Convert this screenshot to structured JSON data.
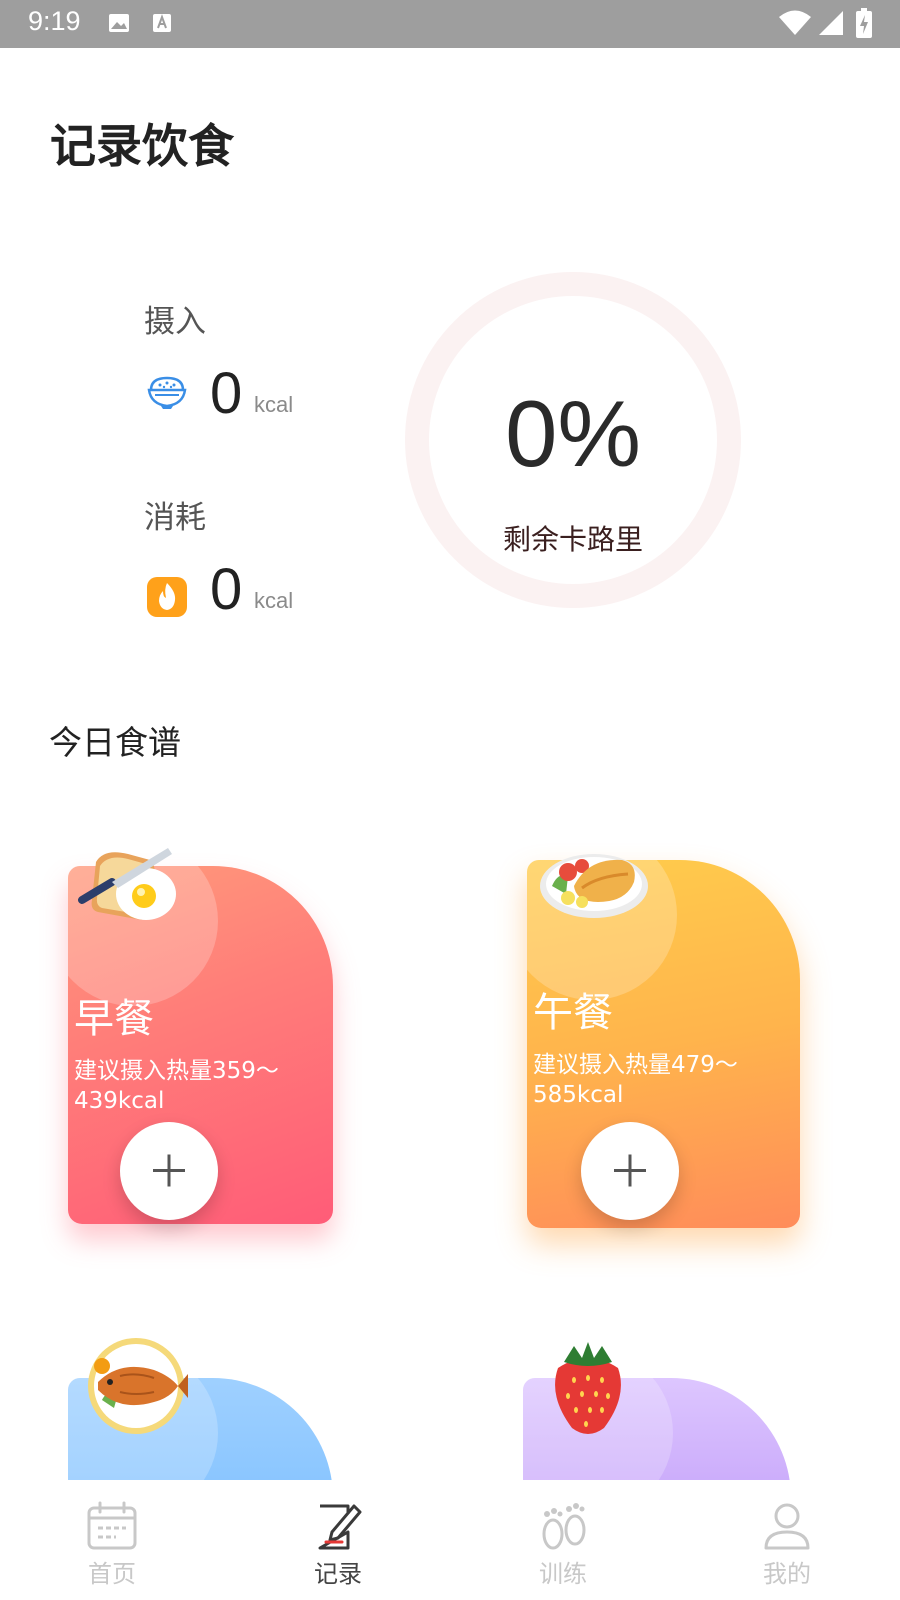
{
  "status_bar": {
    "time": "9:19"
  },
  "header": {
    "title": "记录饮食"
  },
  "intake": {
    "label": "摄入",
    "value": "0",
    "unit": "kcal",
    "icon": "rice-bowl-icon"
  },
  "burn": {
    "label": "消耗",
    "value": "0",
    "unit": "kcal",
    "icon": "fire-icon"
  },
  "ring": {
    "percent": "0%",
    "caption": "剩余卡路里",
    "progress": 0
  },
  "recipes": {
    "title": "今日食谱",
    "cards": [
      {
        "name": "早餐",
        "hint": "建议摄入热量359～439kcal",
        "icon": "fried-egg-toast-icon"
      },
      {
        "name": "午餐",
        "hint": "建议摄入热量479～585kcal",
        "icon": "omelette-plate-icon"
      },
      {
        "name": "",
        "hint": "",
        "icon": "fish-plate-icon"
      },
      {
        "name": "",
        "hint": "",
        "icon": "strawberry-icon"
      }
    ]
  },
  "nav": {
    "items": [
      {
        "label": "首页",
        "icon": "calendar-icon"
      },
      {
        "label": "记录",
        "icon": "edit-note-icon"
      },
      {
        "label": "训练",
        "icon": "footprints-icon"
      },
      {
        "label": "我的",
        "icon": "user-icon"
      }
    ],
    "active_index": 1
  },
  "colors": {
    "breakfast": "#ff6f79",
    "lunch": "#ffb44c",
    "dinner": "#6eb8ff",
    "snack": "#b48af5",
    "intake_icon": "#3a8ee6",
    "burn_icon": "#ffa11a",
    "ring_track": "#fbf2f2"
  }
}
